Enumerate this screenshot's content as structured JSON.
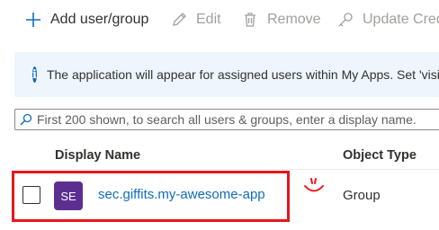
{
  "toolbar": {
    "add_label": "Add user/group",
    "edit_label": "Edit",
    "remove_label": "Remove",
    "update_label": "Update Credentials"
  },
  "banner": {
    "icon": "info-icon",
    "text": "The application will appear for assigned users within My Apps. Set 'visible to users?' to no in properties to prevent this."
  },
  "search": {
    "icon": "search-icon",
    "placeholder": "First 200 shown, to search all users & groups, enter a display name."
  },
  "table": {
    "columns": [
      "Display Name",
      "Object Type"
    ],
    "rows": [
      {
        "initials": "SE",
        "display_name": "sec.giffits.my-awesome-app",
        "object_type": "Group"
      }
    ]
  },
  "colors": {
    "accent": "#0f6cbd",
    "avatar": "#5c2e91",
    "highlight": "#e8141c",
    "banner_bg": "#eef5fc"
  }
}
